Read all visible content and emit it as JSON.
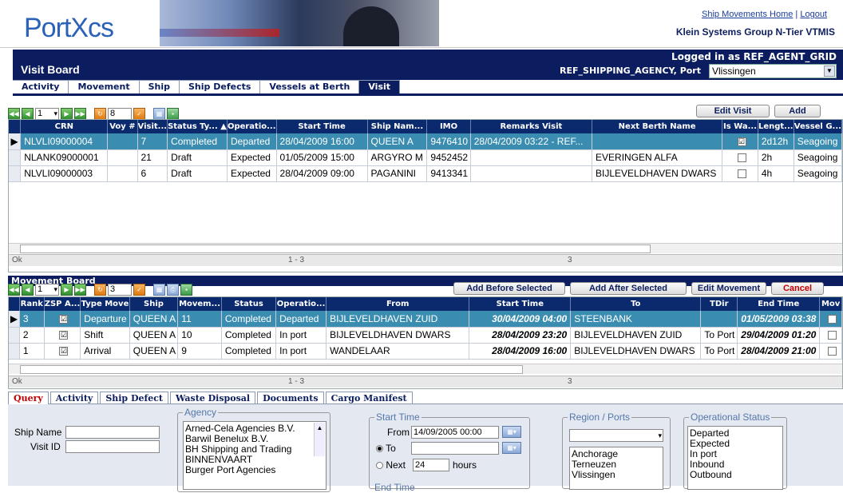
{
  "header": {
    "logo_text": "PortXcs",
    "links": {
      "home": "Ship Movements Home",
      "sep": "|",
      "logout": "Logout"
    },
    "company": "Klein Systems Group N-Tier VTMIS"
  },
  "nav": {
    "page_title": "Visit Board",
    "logged_in": "Logged in as REF_AGENT_GRID",
    "agency_label": "REF_SHIPPING_AGENCY, Port",
    "port_value": "Vlissingen",
    "tabs": [
      "Activity",
      "Movement",
      "Ship",
      "Ship Defects",
      "Vessels at Berth",
      "Visit"
    ]
  },
  "visit_board": {
    "page_select": "1",
    "page_count": "8",
    "buttons": {
      "edit": "Edit Visit",
      "add": "Add"
    },
    "columns": [
      "CRN",
      "Voy #",
      "Visit...",
      "Status Ty... ▲",
      "Operatio...",
      "Start Time",
      "Ship Nam...",
      "IMO",
      "Remarks Visit",
      "Next Berth Name",
      "Is Wa...",
      "Lengt...",
      "Vessel G..."
    ],
    "rows": [
      {
        "crn": "NLVLI09000004",
        "voy": "",
        "visit": "7",
        "status": "Completed",
        "op": "Departed",
        "start": "28/04/2009 16:00",
        "ship": "QUEEN A",
        "imo": "9476410",
        "remarks": "28/04/2009 03:22 - REF...",
        "berth": "",
        "wa": "☑",
        "len": "2d12h",
        "vg": "Seagoing"
      },
      {
        "crn": "NLANK09000001",
        "voy": "",
        "visit": "21",
        "status": "Draft",
        "op": "Expected",
        "start": "01/05/2009 15:00",
        "ship": "ARGYRO M",
        "imo": "9452452",
        "remarks": "",
        "berth": "EVERINGEN ALFA",
        "wa": "",
        "len": "2h",
        "vg": "Seagoing"
      },
      {
        "crn": "NLVLI09000003",
        "voy": "",
        "visit": "6",
        "status": "Draft",
        "op": "Expected",
        "start": "28/04/2009 09:00",
        "ship": "PAGANINI",
        "imo": "9413341",
        "remarks": "",
        "berth": "BIJLEVELDHAVEN DWARS",
        "wa": "",
        "len": "4h",
        "vg": "Seagoing"
      }
    ],
    "status_ok": "Ok",
    "status_range": "1 - 3",
    "status_count": "3"
  },
  "movement_board": {
    "title": "Movement Board",
    "page_select": "1",
    "page_count": "3",
    "buttons": {
      "add_before": "Add Before Selected",
      "add_after": "Add After Selected",
      "edit": "Edit Movement",
      "cancel": "Cancel"
    },
    "columns": [
      "Rank",
      "ZSP A...",
      "Type Move",
      "Ship",
      "Movem...",
      "Status",
      "Operatio...",
      "From",
      "Start Time",
      "To",
      "TDir",
      "End Time",
      "Mov"
    ],
    "rows": [
      {
        "rank": "3",
        "zsp": "☑",
        "type": "Departure",
        "ship": "QUEEN A",
        "mov": "11",
        "status": "Completed",
        "op": "Departed",
        "from": "BIJLEVELDHAVEN ZUID",
        "start": "30/04/2009 04:00",
        "to": "STEENBANK",
        "tdir": "",
        "end": "01/05/2009 03:38"
      },
      {
        "rank": "2",
        "zsp": "☑",
        "type": "Shift",
        "ship": "QUEEN A",
        "mov": "10",
        "status": "Completed",
        "op": "In port",
        "from": "BIJLEVELDHAVEN DWARS",
        "start": "28/04/2009 23:20",
        "to": "BIJLEVELDHAVEN ZUID",
        "tdir": "To Port",
        "end": "29/04/2009 01:20"
      },
      {
        "rank": "1",
        "zsp": "☑",
        "type": "Arrival",
        "ship": "QUEEN A",
        "mov": "9",
        "status": "Completed",
        "op": "In port",
        "from": "WANDELAAR",
        "start": "28/04/2009 16:00",
        "to": "BIJLEVELDHAVEN DWARS",
        "tdir": "To Port",
        "end": "28/04/2009 21:00"
      }
    ],
    "status_ok": "Ok",
    "status_range": "1 - 3",
    "status_count": "3"
  },
  "bottom_tabs": [
    "Query",
    "Activity",
    "Ship Defect",
    "Waste Disposal",
    "Documents",
    "Cargo Manifest"
  ],
  "query": {
    "ship_name_label": "Ship Name",
    "visit_id_label": "Visit ID",
    "agency_legend": "Agency",
    "agencies": [
      "Arned-Cela Agencies B.V.",
      "Barwil Benelux B.V.",
      "BH Shipping and Trading",
      "BINNENVAART",
      "Burger Port Agencies"
    ],
    "start_legend": "Start Time",
    "from_label": "From",
    "from_value": "14/09/2005 00:00",
    "to_label": "To",
    "next_label": "Next",
    "next_value": "24",
    "hours_label": "hours",
    "end_legend": "End Time",
    "region_legend": "Region / Ports",
    "regions": [
      "Anchorage",
      "Terneuzen",
      "Vlissingen"
    ],
    "opstatus_legend": "Operational Status",
    "opstatus": [
      "Departed",
      "Expected",
      "In port",
      "Inbound",
      "Outbound"
    ]
  }
}
